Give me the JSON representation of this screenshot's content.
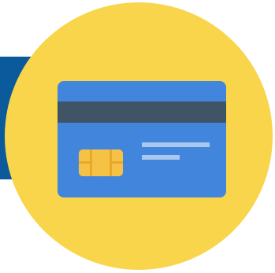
{
  "icon": {
    "name": "credit-card-icon",
    "colors": {
      "band": "#0a5a9c",
      "circle": "#f8d54a",
      "card": "#4285dc",
      "stripe": "#3f5565",
      "chip": "#f5c246",
      "chip_lines": "#e8a92a",
      "text_lines": "#a8c8f0",
      "background": "#ffffff"
    }
  }
}
